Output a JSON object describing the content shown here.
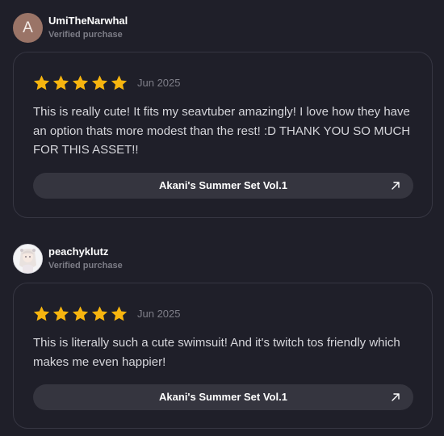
{
  "reviews": [
    {
      "reviewer": {
        "name": "UmiTheNarwhal",
        "badge": "Verified purchase",
        "avatar_letter": "A",
        "avatar_color": "#9a7467"
      },
      "rating": 5,
      "date": "Jun 2025",
      "text": "This is really cute! It fits my seavtuber amazingly! I love how they have an option thats more modest than the rest! :D THANK YOU SO MUCH FOR THIS ASSET!!",
      "product": {
        "label": "Akani's Summer Set Vol.1",
        "icon": "arrow-up-right-icon"
      }
    },
    {
      "reviewer": {
        "name": "peachyklutz",
        "badge": "Verified purchase",
        "avatar_icon": "anime-character-avatar"
      },
      "rating": 5,
      "date": "Jun 2025",
      "text": "This is literally such a cute swimsuit! And it's twitch tos friendly which makes me even happier!",
      "product": {
        "label": "Akani's Summer Set Vol.1",
        "icon": "arrow-up-right-icon"
      }
    }
  ],
  "colors": {
    "background": "#1f1f29",
    "card_border": "#363642",
    "star": "#f7b50f",
    "button_bg": "#35353f",
    "muted_text": "#7c7c86"
  }
}
